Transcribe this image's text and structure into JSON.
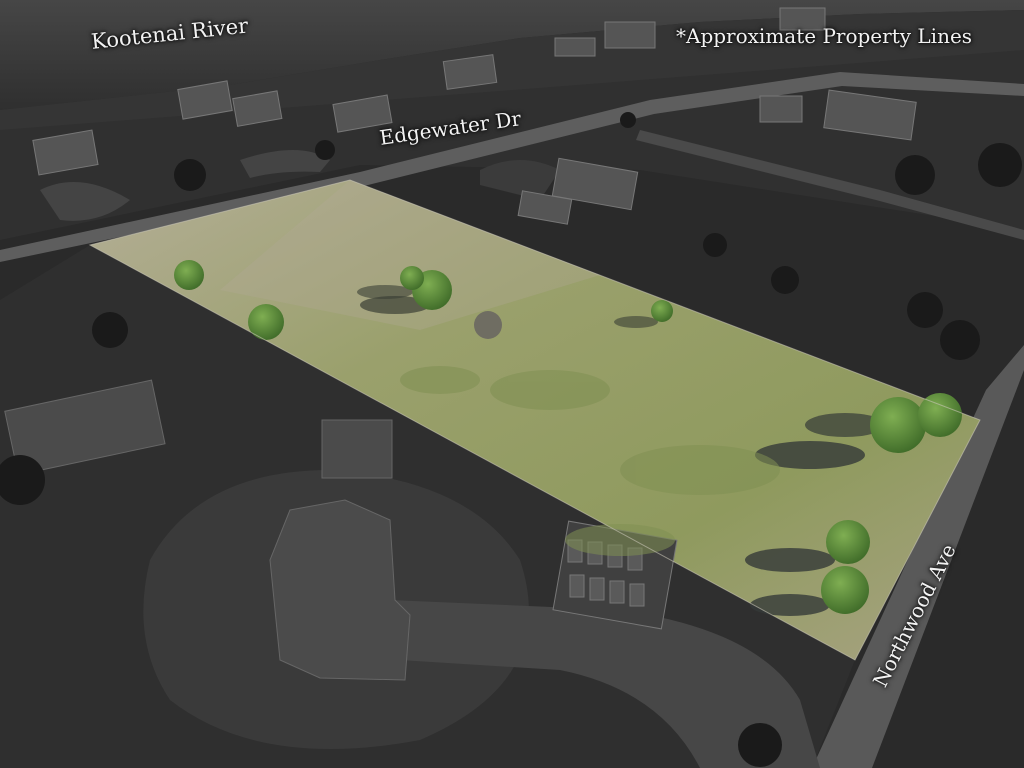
{
  "labels": {
    "river": "Kootenai River",
    "property_note": "*Approximate Property Lines",
    "street_north": "Edgewater Dr",
    "street_east": "Northwood Ave"
  },
  "colors": {
    "parcel_grass": "#8f9a5e",
    "surroundings": "#2b2b2b",
    "river": "#3c3c3c",
    "road": "#5e5e5e",
    "label_text": "#f2f2f2"
  }
}
